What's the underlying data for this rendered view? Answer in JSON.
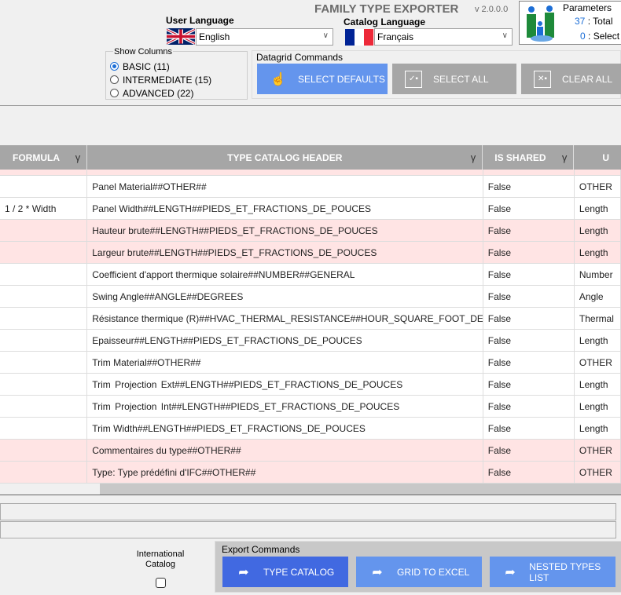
{
  "app": {
    "title": "FAMILY TYPE EXPORTER",
    "version": "v 2.0.0.0"
  },
  "user_language": {
    "label": "User Language",
    "value": "English"
  },
  "catalog_language": {
    "label": "Catalog Language",
    "value": "Français"
  },
  "parameters": {
    "title": "Parameters",
    "total_count": "37",
    "total_label": " : Total",
    "selected_count": "0",
    "selected_label": " : Select"
  },
  "show_columns": {
    "label": "Show Columns",
    "options": [
      {
        "label": "BASIC  (11)",
        "checked": true
      },
      {
        "label": "INTERMEDIATE  (15)",
        "checked": false
      },
      {
        "label": "ADVANCED  (22)",
        "checked": false
      }
    ]
  },
  "datagrid_commands": {
    "label": "Datagrid Commands",
    "select_defaults": "SELECT DEFAULTS",
    "select_all": "SELECT ALL",
    "clear_all": "CLEAR ALL"
  },
  "grid": {
    "columns": [
      "FORMULA",
      "TYPE CATALOG HEADER",
      "IS SHARED",
      "U"
    ],
    "rows": [
      {
        "formula": "",
        "header": "Panel Material##OTHER##",
        "shared": "False",
        "unit": "OTHER",
        "pink": false
      },
      {
        "formula": "1 / 2 * Width",
        "header": "Panel Width##LENGTH##PIEDS_ET_FRACTIONS_DE_POUCES",
        "shared": "False",
        "unit": "Length",
        "pink": false
      },
      {
        "formula": "",
        "header": "Hauteur brute##LENGTH##PIEDS_ET_FRACTIONS_DE_POUCES",
        "shared": "False",
        "unit": "Length",
        "pink": true
      },
      {
        "formula": "",
        "header": "Largeur brute##LENGTH##PIEDS_ET_FRACTIONS_DE_POUCES",
        "shared": "False",
        "unit": "Length",
        "pink": true
      },
      {
        "formula": "",
        "header": "Coefficient d'apport thermique solaire##NUMBER##GENERAL",
        "shared": "False",
        "unit": "Number",
        "pink": false
      },
      {
        "formula": "",
        "header": "Swing Angle##ANGLE##DEGREES",
        "shared": "False",
        "unit": "Angle",
        "pink": false
      },
      {
        "formula": "",
        "header": "Résistance thermique (R)##HVAC_THERMAL_RESISTANCE##HOUR_SQUARE_FOOT_DEGRE...",
        "shared": "False",
        "unit": "Thermal",
        "pink": false
      },
      {
        "formula": "",
        "header": "Epaisseur##LENGTH##PIEDS_ET_FRACTIONS_DE_POUCES",
        "shared": "False",
        "unit": "Length",
        "pink": false
      },
      {
        "formula": "",
        "header": "Trim Material##OTHER##",
        "shared": "False",
        "unit": "OTHER",
        "pink": false
      },
      {
        "formula": "",
        "header": "Trim Projection Ext##LENGTH##PIEDS_ET_FRACTIONS_DE_POUCES",
        "shared": "False",
        "unit": "Length",
        "pink": false
      },
      {
        "formula": "",
        "header": "Trim Projection Int##LENGTH##PIEDS_ET_FRACTIONS_DE_POUCES",
        "shared": "False",
        "unit": "Length",
        "pink": false
      },
      {
        "formula": "",
        "header": "Trim Width##LENGTH##PIEDS_ET_FRACTIONS_DE_POUCES",
        "shared": "False",
        "unit": "Length",
        "pink": false
      },
      {
        "formula": "",
        "header": "Commentaires du type##OTHER##",
        "shared": "False",
        "unit": "OTHER",
        "pink": true
      },
      {
        "formula": "",
        "header": "Type: Type prédéfini d'IFC##OTHER##",
        "shared": "False",
        "unit": "OTHER",
        "pink": true
      }
    ]
  },
  "international_catalog": {
    "label": "International Catalog",
    "checked": false
  },
  "export_commands": {
    "label": "Export Commands",
    "type_catalog": "TYPE CATALOG",
    "grid_to_excel": "GRID TO EXCEL",
    "nested_types_list": "NESTED TYPES LIST"
  },
  "colors": {
    "primary": "#4169e1",
    "light": "#6495ed",
    "gray": "#a6a6a6",
    "pink": "#ffe4e4"
  }
}
